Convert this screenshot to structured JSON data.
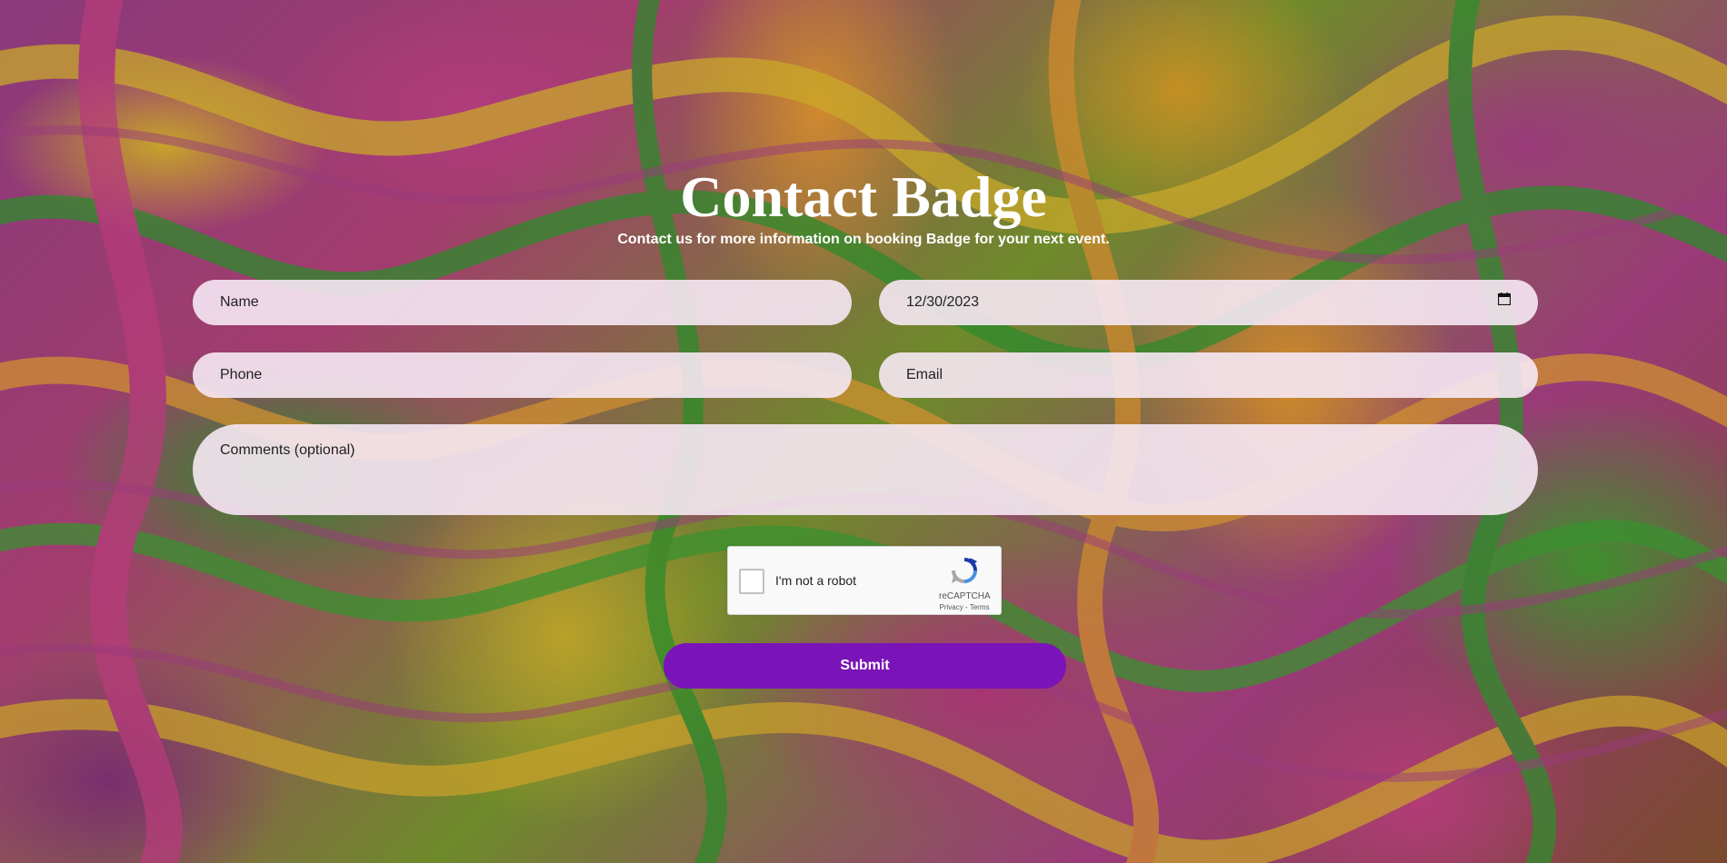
{
  "header": {
    "title": "Contact Badge",
    "subtitle": "Contact us for more information on booking Badge for your next event."
  },
  "form": {
    "name_placeholder": "Name",
    "date_value": "12/30/2023",
    "phone_placeholder": "Phone",
    "email_placeholder": "Email",
    "comments_placeholder": "Comments (optional)",
    "submit_label": "Submit"
  },
  "captcha": {
    "label": "I'm not a robot",
    "brand": "reCAPTCHA",
    "links": "Privacy - Terms",
    "checked": false
  },
  "colors": {
    "submit_bg": "#7a14b8",
    "field_bg": "#f6e8f4",
    "title_text": "#ffffff"
  }
}
